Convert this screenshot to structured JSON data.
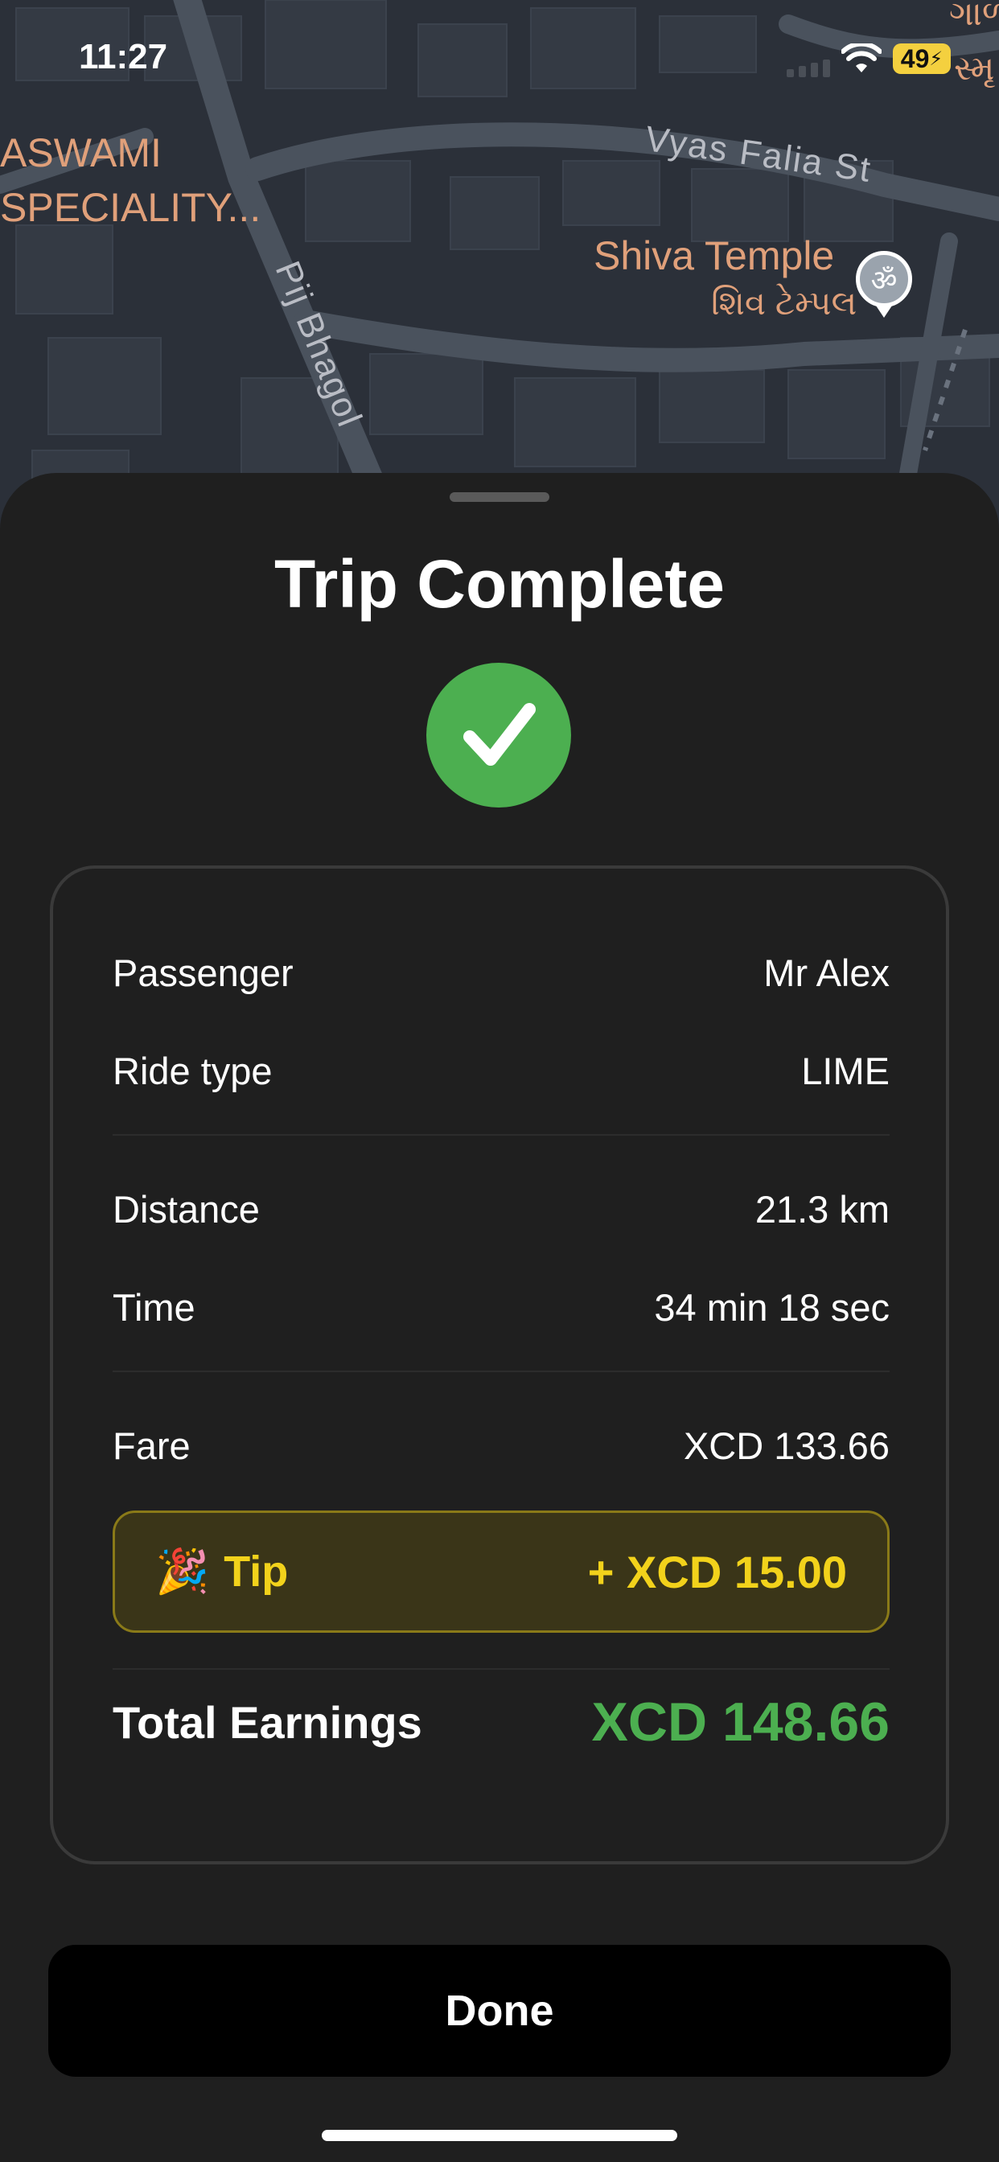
{
  "status_bar": {
    "time": "11:27",
    "battery": "49"
  },
  "map": {
    "labels": {
      "hospital_line1": "ASWAMI",
      "hospital_line2": "SPECIALITY...",
      "temple_en": "Shiva Temple",
      "temple_gu": "શિવ ટેમ્પલ",
      "top_right_gu": "ગાળ",
      "right_edge_gu": "સ્મૃ"
    },
    "streets": {
      "vyas": "Vyas Falia St",
      "pij": "Pij Bhagol"
    },
    "poi_icon": "om-icon"
  },
  "sheet": {
    "title": "Trip Complete",
    "details": {
      "passenger_label": "Passenger",
      "passenger_value": "Mr Alex",
      "ride_type_label": "Ride type",
      "ride_type_value": "LIME",
      "distance_label": "Distance",
      "distance_value": "21.3 km",
      "time_label": "Time",
      "time_value": "34 min 18 sec",
      "fare_label": "Fare",
      "fare_value": "XCD 133.66"
    },
    "tip": {
      "icon": "🎉",
      "label": "Tip",
      "value": "+ XCD 15.00"
    },
    "total": {
      "label": "Total Earnings",
      "value": "XCD 148.66"
    },
    "done_label": "Done"
  },
  "colors": {
    "accent_green": "#4caf50",
    "tip_yellow": "#f2d21b",
    "sheet_bg": "#1f1f1f",
    "map_bg": "#2b3039"
  }
}
